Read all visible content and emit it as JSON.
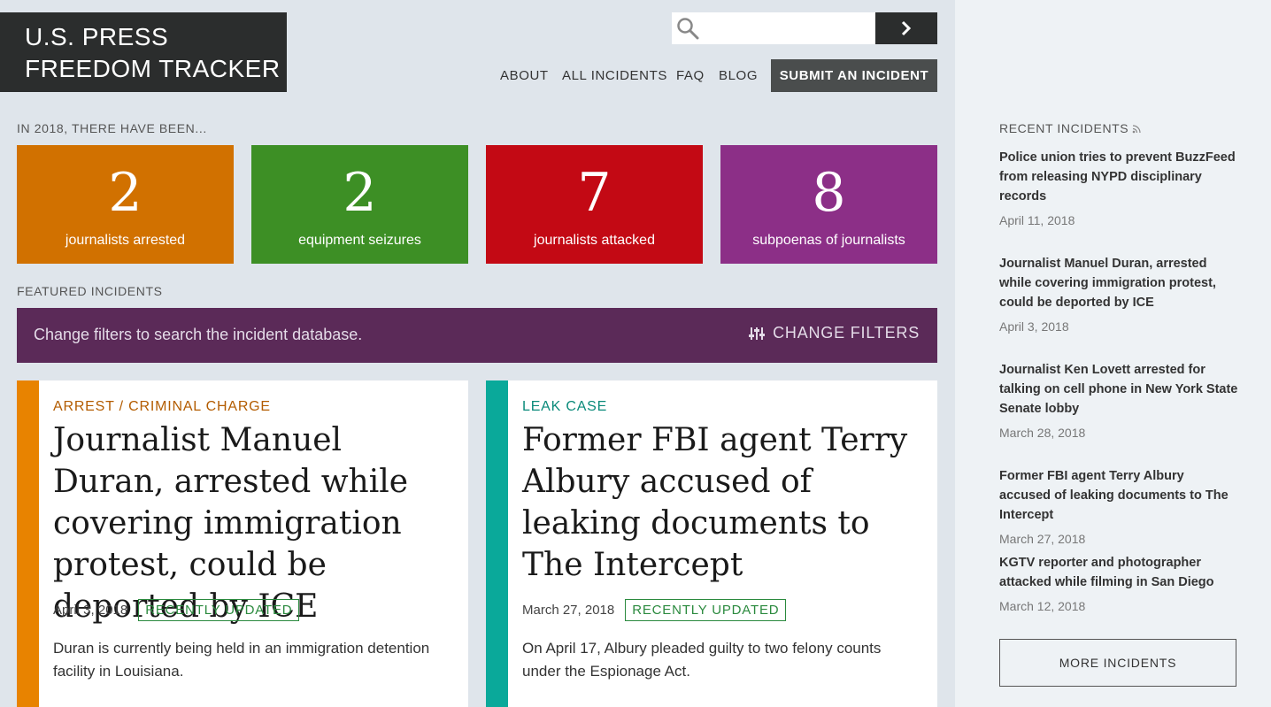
{
  "logo": {
    "line1": "U.S. PRESS",
    "line2": "FREEDOM TRACKER"
  },
  "search": {
    "value": "",
    "placeholder": ""
  },
  "nav": {
    "about": "ABOUT",
    "all_incidents": "ALL INCIDENTS",
    "faq": "FAQ",
    "blog": "BLOG",
    "submit": "SUBMIT AN INCIDENT"
  },
  "intro_label": "IN 2018, THERE HAVE BEEN...",
  "stats": [
    {
      "num": "2",
      "label": "journalists arrested",
      "color": "#d17100"
    },
    {
      "num": "2",
      "label": "equipment seizures",
      "color": "#3d8f25"
    },
    {
      "num": "7",
      "label": "journalists attacked",
      "color": "#c30914"
    },
    {
      "num": "8",
      "label": "subpoenas of journalists",
      "color": "#8c2f87"
    }
  ],
  "featured_label": "FEATURED INCIDENTS",
  "filters": {
    "text": "Change filters to search the incident database.",
    "button": "CHANGE FILTERS"
  },
  "cards": [
    {
      "category": "ARREST / CRIMINAL CHARGE",
      "category_color": "#b35c00",
      "stripe_color": "#e88300",
      "title": "Journalist Manuel Duran, arrested while covering immigration protest, could be deported by ICE",
      "date": "April 3, 2018",
      "badge": "RECENTLY UPDATED",
      "desc": "Duran is currently being held in an immigration detention facility in Louisiana."
    },
    {
      "category": "LEAK CASE",
      "category_color": "#0a8a7a",
      "stripe_color": "#0aa99a",
      "title": "Former FBI agent Terry Albury accused of leaking documents to The Intercept",
      "date": "March 27, 2018",
      "badge": "RECENTLY UPDATED",
      "desc": "On April 17, Albury pleaded guilty to two felony counts under the Espionage Act."
    }
  ],
  "recent": {
    "label": "RECENT INCIDENTS",
    "items": [
      {
        "title": "Police union tries to prevent BuzzFeed from releasing NYPD disciplinary records",
        "date": "April 11, 2018"
      },
      {
        "title": "Journalist Manuel Duran, arrested while covering immigration protest, could be deported by ICE",
        "date": "April 3, 2018"
      },
      {
        "title": "Journalist Ken Lovett arrested for talking on cell phone in New York State Senate lobby",
        "date": "March 28, 2018"
      },
      {
        "title": "Former FBI agent Terry Albury accused of leaking documents to The Intercept",
        "date": "March 27, 2018"
      },
      {
        "title": "KGTV reporter and photographer attacked while filming in San Diego",
        "date": "March 12, 2018"
      }
    ],
    "more": "MORE INCIDENTS"
  }
}
